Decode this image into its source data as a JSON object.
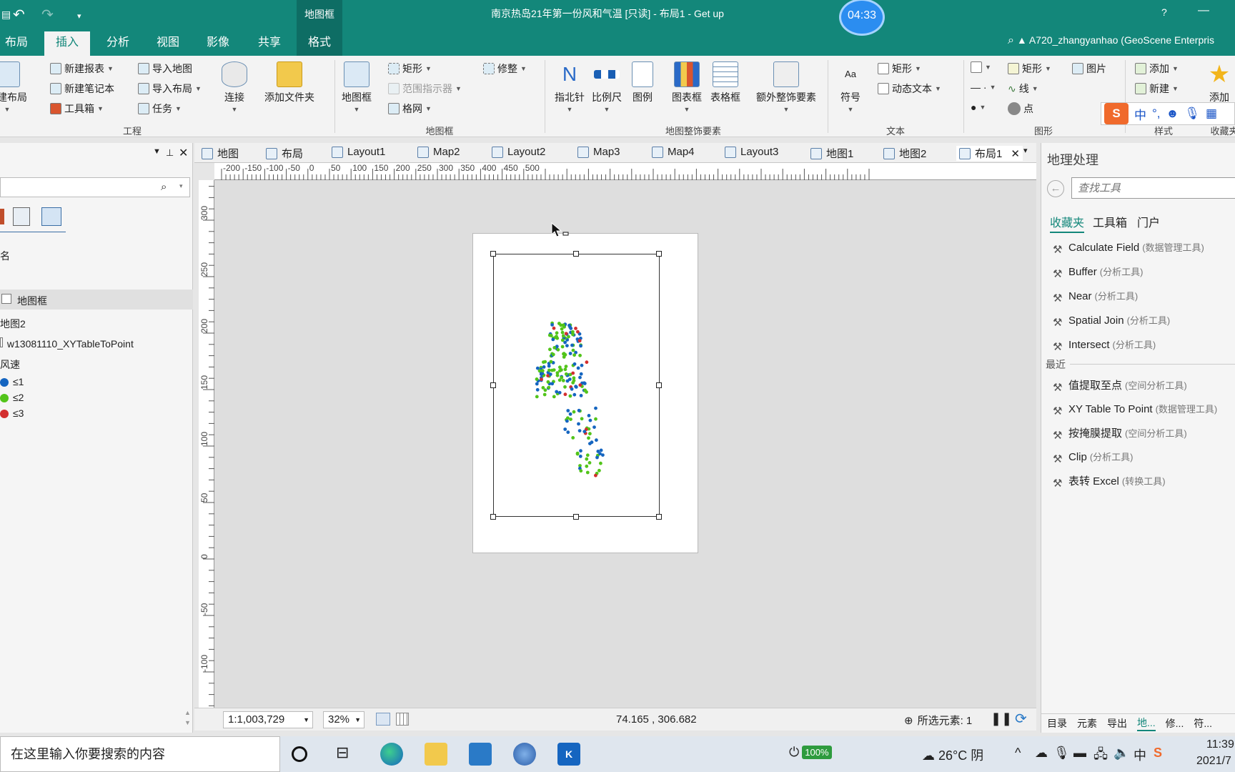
{
  "window": {
    "title": "南京热岛21年第一份风和气温 [只读] - 布局1 - Get up",
    "context_tab_group": "地图框",
    "timer": "04:33",
    "help": "?",
    "minimize": "—",
    "user": "A720_zhangyanhao (GeoScene Enterpris"
  },
  "ribbon_tabs": [
    "布局",
    "插入",
    "分析",
    "视图",
    "影像",
    "共享",
    "格式"
  ],
  "ribbon": {
    "project": {
      "new_layout": "新建布局",
      "new_report": "新建报表",
      "new_notebook": "新建笔记本",
      "toolbox": "工具箱",
      "import_map": "导入地图",
      "import_layout": "导入布局",
      "task": "任务",
      "connect": "连接",
      "add_folder": "添加文件夹",
      "label": "工程"
    },
    "mapframe": {
      "map_frame": "地图框",
      "rectangle": "矩形",
      "extent_indicator": "范围指示器",
      "grid": "格网",
      "reshape": "修整",
      "label": "地图框"
    },
    "surrounds": {
      "north_arrow": "指北针",
      "scale_bar": "比例尺",
      "legend": "图例",
      "chart_frame": "图表框",
      "table_frame": "表格框",
      "extra_surrounds": "额外整饰要素",
      "label": "地图整饰要素"
    },
    "text": {
      "symbol": "符号",
      "rectangle": "矩形",
      "dynamic_text": "动态文本",
      "label": "文本"
    },
    "graphics": {
      "rectangle": "矩形",
      "line": "线",
      "point": "点",
      "picture": "图片",
      "label": "图形"
    },
    "styles": {
      "add": "添加",
      "new": "新建",
      "label": "样式",
      "favorites_add": "添加",
      "favorites": "收藏夹"
    }
  },
  "ime": {
    "logo": "S",
    "mode": "中"
  },
  "contents": {
    "section": "名",
    "map_frame": "地图框",
    "map": "地图2",
    "layer": "w13081110_XYTableToPoint",
    "field": "风速",
    "legend": [
      {
        "label": "≤1",
        "color": "#1565c0"
      },
      {
        "label": "≤2",
        "color": "#52c41a"
      },
      {
        "label": "≤3",
        "color": "#d32f2f"
      }
    ]
  },
  "doc_tabs": [
    "地图",
    "布局",
    "Layout1",
    "Map2",
    "Layout2",
    "Map3",
    "Map4",
    "Layout3",
    "地图1",
    "地图2",
    "布局1"
  ],
  "ruler": {
    "h_labels": [
      "-200",
      "-150",
      "-100",
      "-50",
      "0",
      "50",
      "100",
      "150",
      "200",
      "250",
      "300",
      "350",
      "400",
      "450",
      "500"
    ],
    "v_labels": [
      "300",
      "250",
      "200",
      "150",
      "100",
      "50",
      "0",
      "-50",
      "-100"
    ]
  },
  "statusbar": {
    "scale": "1:1,003,729",
    "zoom": "32%",
    "coords": "74.165 , 306.682",
    "selected": "所选元素: 1"
  },
  "geoprocessing": {
    "title": "地理处理",
    "search_placeholder": "查找工具",
    "tabs": [
      "收藏夹",
      "工具箱",
      "门户"
    ],
    "favorites": [
      {
        "name": "Calculate Field",
        "toolbox": "(数据管理工具)"
      },
      {
        "name": "Buffer",
        "toolbox": "(分析工具)"
      },
      {
        "name": "Near",
        "toolbox": "(分析工具)"
      },
      {
        "name": "Spatial Join",
        "toolbox": "(分析工具)"
      },
      {
        "name": "Intersect",
        "toolbox": "(分析工具)"
      }
    ],
    "recent_label": "最近",
    "recent": [
      {
        "name": "值提取至点",
        "toolbox": "(空间分析工具)"
      },
      {
        "name": "XY Table To Point",
        "toolbox": "(数据管理工具)"
      },
      {
        "name": "按掩膜提取",
        "toolbox": "(空间分析工具)"
      },
      {
        "name": "Clip",
        "toolbox": "(分析工具)"
      },
      {
        "name": "表转 Excel",
        "toolbox": "(转换工具)"
      }
    ],
    "bottom_tabs": [
      "目录",
      "元素",
      "导出",
      "地...",
      "修...",
      "符..."
    ]
  },
  "taskbar": {
    "search": "在这里输入你要搜索的内容",
    "battery": "100%",
    "weather": "26°C 阴",
    "ime": "中",
    "time": "11:39",
    "date": "2021/7"
  }
}
